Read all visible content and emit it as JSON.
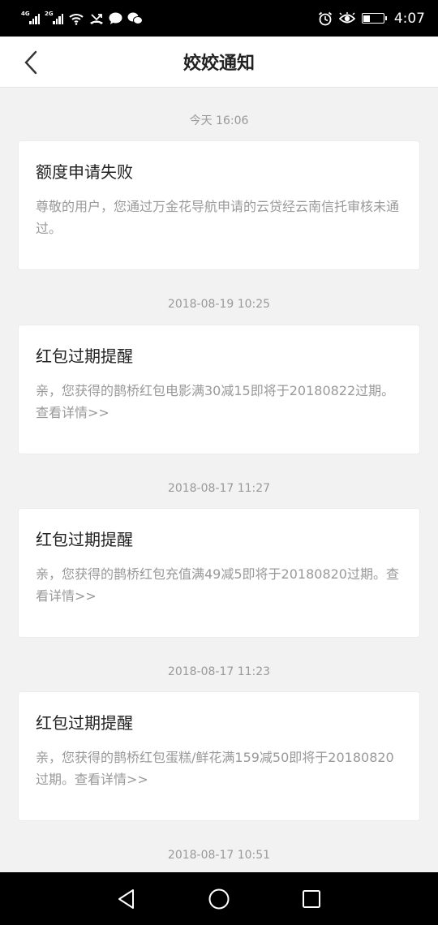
{
  "status_bar": {
    "net1": "4G",
    "net2": "2G",
    "time": "4:07",
    "icons": [
      "signal-icon",
      "signal-icon",
      "wifi-icon",
      "missed-call-icon",
      "message-icon",
      "wechat-icon",
      "alarm-icon",
      "eye-icon",
      "battery-icon"
    ]
  },
  "header": {
    "title": "姣姣通知"
  },
  "notifications": [
    {
      "time": "今天 16:06",
      "title": "额度申请失败",
      "body": "尊敬的用户，您通过万金花导航申请的云贷经云南信托审核未通过。"
    },
    {
      "time": "2018-08-19 10:25",
      "title": "红包过期提醒",
      "body": "亲，您获得的鹊桥红包电影满30减15即将于20180822过期。查看详情>>"
    },
    {
      "time": "2018-08-17 11:27",
      "title": "红包过期提醒",
      "body": "亲，您获得的鹊桥红包充值满49减5即将于20180820过期。查看详情>>"
    },
    {
      "time": "2018-08-17 11:23",
      "title": "红包过期提醒",
      "body": "亲，您获得的鹊桥红包蛋糕/鲜花满159减50即将于20180820过期。查看详情>>"
    },
    {
      "time": "2018-08-17 10:51"
    }
  ]
}
